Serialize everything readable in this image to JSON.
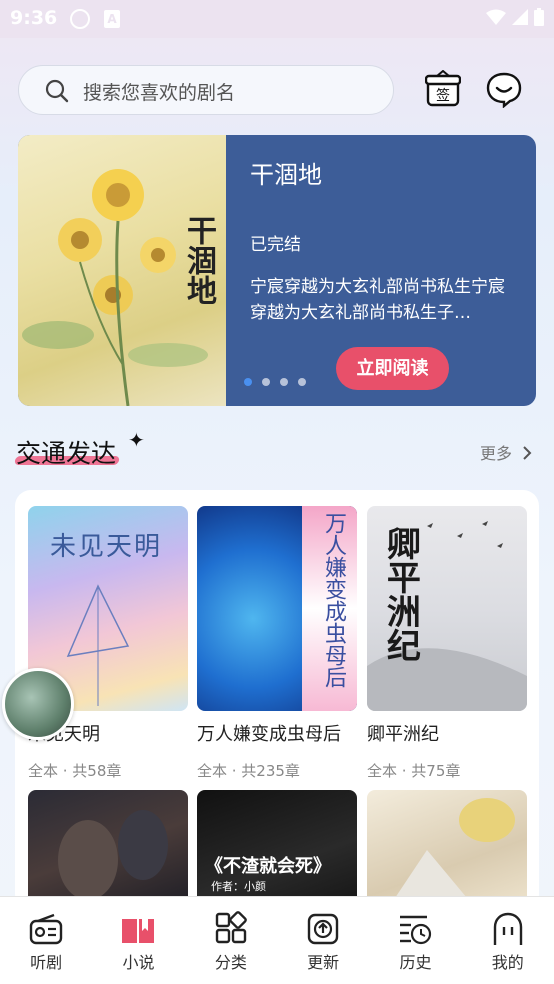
{
  "status_bar": {
    "time": "9:36",
    "notification_glyph": "A"
  },
  "search": {
    "placeholder": "搜索您喜欢的剧名"
  },
  "header_icons": {
    "checkin": "sign-in-icon",
    "message": "message-icon"
  },
  "banner": {
    "title": "干涸地",
    "status": "已完结",
    "description": "宁宸穿越为大玄礼部尚书私生宁宸穿越为大玄礼部尚书私生子…",
    "read_button": "立即阅读",
    "cover_text": "干涸地",
    "dots": 4,
    "active_dot": 0
  },
  "section": {
    "title": "交通发达",
    "more": "更多"
  },
  "books": [
    {
      "name": "未见天明",
      "meta": "全本 · 共58章",
      "cover_text": "未见天明"
    },
    {
      "name": "万人嫌变成虫母后",
      "meta": "全本 · 共235章",
      "cover_text": "万人嫌变成虫母后"
    },
    {
      "name": "卿平洲纪",
      "meta": "全本 · 共75章",
      "cover_text": "卿平洲纪"
    }
  ],
  "books_row2": [
    {
      "cover_text": ""
    },
    {
      "cover_text": "《不渣就会死》",
      "author": "作者：小颜"
    },
    {
      "cover_text": ""
    }
  ],
  "tabs": [
    {
      "label": "听剧",
      "icon": "radio-icon"
    },
    {
      "label": "小说",
      "icon": "book-icon",
      "active": true
    },
    {
      "label": "分类",
      "icon": "category-icon"
    },
    {
      "label": "更新",
      "icon": "update-icon"
    },
    {
      "label": "历史",
      "icon": "history-icon"
    },
    {
      "label": "我的",
      "icon": "ghost-icon"
    }
  ],
  "colors": {
    "accent": "#e8506a",
    "banner_bg": "#3d5d98",
    "tab_active": "#e8506a"
  }
}
